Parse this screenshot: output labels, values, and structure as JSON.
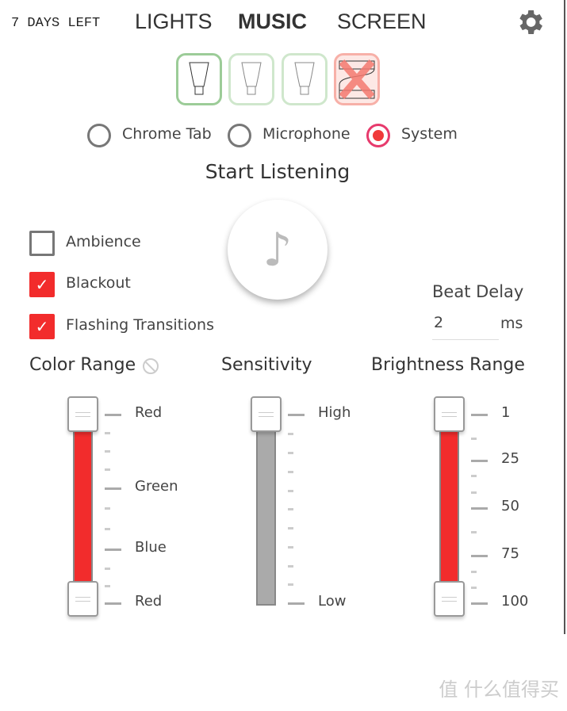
{
  "header": {
    "trial": "7 DAYS LEFT",
    "tabs": [
      {
        "label": "LIGHTS"
      },
      {
        "label": "MUSIC",
        "active": true
      },
      {
        "label": "SCREEN"
      }
    ],
    "settings_icon": "gear-icon"
  },
  "devices": [
    {
      "type": "bulb",
      "state": "selected"
    },
    {
      "type": "bulb",
      "state": "available"
    },
    {
      "type": "bulb",
      "state": "available"
    },
    {
      "type": "lightstrip",
      "state": "unavailable"
    }
  ],
  "source": {
    "options": [
      "Chrome Tab",
      "Microphone",
      "System"
    ],
    "selected": "System"
  },
  "listen": {
    "label": "Start Listening",
    "icon": "music-note-icon"
  },
  "options": [
    {
      "label": "Ambience",
      "checked": false
    },
    {
      "label": "Blackout",
      "checked": true
    },
    {
      "label": "Flashing Transitions",
      "checked": true
    }
  ],
  "beat_delay": {
    "label": "Beat Delay",
    "value": "2",
    "unit": "ms"
  },
  "color_range": {
    "label": "Color Range",
    "labels": [
      "Red",
      "Green",
      "Blue",
      "Red"
    ],
    "fill": "#f22c2c"
  },
  "sensitivity": {
    "label": "Sensitivity",
    "labels": [
      "High",
      "Low"
    ],
    "fill": "#aaaaaa"
  },
  "brightness_range": {
    "label": "Brightness Range",
    "labels": [
      "1",
      "25",
      "50",
      "75",
      "100"
    ],
    "min": 1,
    "max": 100,
    "fill": "#f22c2c"
  },
  "watermark": "值 什么值得买"
}
